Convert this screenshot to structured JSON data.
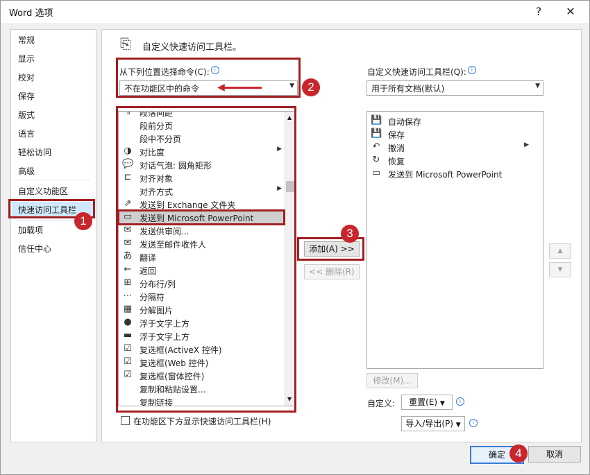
{
  "window": {
    "title": "Word 选项",
    "help": "?",
    "close": "✕"
  },
  "nav": {
    "items": [
      "常规",
      "显示",
      "校对",
      "保存",
      "版式",
      "语言",
      "轻松访问",
      "高级",
      "自定义功能区",
      "快速访问工具栏",
      "加载项",
      "信任中心"
    ],
    "selected": "快速访问工具栏"
  },
  "main": {
    "heading": "自定义快速访问工具栏。",
    "choose_label": "从下列位置选择命令(C):",
    "choose_value": "不在功能区中的命令",
    "qat_label": "自定义快速访问工具栏(Q):",
    "qat_value": "用于所有文档(默认)",
    "commands": [
      {
        "label": "段落间距",
        "icon": "paragraph-spacing-icon",
        "glyph": "¶",
        "submenu": false
      },
      {
        "label": "段前分页",
        "icon": "",
        "glyph": "",
        "submenu": false
      },
      {
        "label": "段中不分页",
        "icon": "",
        "glyph": "",
        "submenu": false
      },
      {
        "label": "对比度",
        "icon": "contrast-icon",
        "glyph": "◑",
        "submenu": true
      },
      {
        "label": "对话气泡: 圆角矩形",
        "icon": "speech-bubble-icon",
        "glyph": "💬",
        "submenu": false
      },
      {
        "label": "对齐对象",
        "icon": "align-objects-icon",
        "glyph": "⊏",
        "submenu": false
      },
      {
        "label": "对齐方式",
        "icon": "",
        "glyph": "",
        "submenu": true
      },
      {
        "label": "发送到 Exchange 文件夹",
        "icon": "exchange-folder-icon",
        "glyph": "⇗",
        "submenu": false
      },
      {
        "label": "发送到 Microsoft PowerPoint",
        "icon": "powerpoint-icon",
        "glyph": "▭",
        "submenu": false
      },
      {
        "label": "发送供审阅...",
        "icon": "review-icon",
        "glyph": "✉",
        "submenu": false
      },
      {
        "label": "发送至邮件收件人",
        "icon": "mail-recipient-icon",
        "glyph": "✉",
        "submenu": false
      },
      {
        "label": "翻译",
        "icon": "translate-icon",
        "glyph": "あ",
        "submenu": false
      },
      {
        "label": "返回",
        "icon": "back-icon",
        "glyph": "←",
        "submenu": false
      },
      {
        "label": "分布行/列",
        "icon": "distribute-rows-icon",
        "glyph": "⊞",
        "submenu": false
      },
      {
        "label": "分隔符",
        "icon": "break-icon",
        "glyph": "⋯",
        "submenu": false
      },
      {
        "label": "分解图片",
        "icon": "ungroup-picture-icon",
        "glyph": "▦",
        "submenu": false
      },
      {
        "label": "浮于文字上方",
        "icon": "float-over-text-icon",
        "glyph": "●",
        "submenu": false
      },
      {
        "label": "浮于文字上方",
        "icon": "bring-forward-icon",
        "glyph": "▬",
        "submenu": false
      },
      {
        "label": "复选框(ActiveX 控件)",
        "icon": "checkbox-activex-icon",
        "glyph": "☑",
        "submenu": false
      },
      {
        "label": "复选框(Web 控件)",
        "icon": "checkbox-web-icon",
        "glyph": "☑",
        "submenu": false
      },
      {
        "label": "复选框(窗体控件)",
        "icon": "checkbox-form-icon",
        "glyph": "☑",
        "submenu": false
      },
      {
        "label": "复制和粘贴设置...",
        "icon": "",
        "glyph": "",
        "submenu": false
      },
      {
        "label": "复制链接",
        "icon": "",
        "glyph": "",
        "submenu": false
      }
    ],
    "selected_command": "发送到 Microsoft PowerPoint",
    "qat_items": [
      {
        "label": "自动保存",
        "icon": "autosave-icon",
        "glyph": "💾",
        "submenu": false
      },
      {
        "label": "保存",
        "icon": "save-icon",
        "glyph": "💾",
        "submenu": false
      },
      {
        "label": "撤消",
        "icon": "undo-icon",
        "glyph": "↶",
        "submenu": true
      },
      {
        "label": "恢复",
        "icon": "redo-icon",
        "glyph": "↻",
        "submenu": false
      },
      {
        "label": "发送到 Microsoft PowerPoint",
        "icon": "powerpoint-icon",
        "glyph": "▭",
        "submenu": false
      }
    ],
    "add_button": "添加(A) >>",
    "remove_button": "<< 删除(R)",
    "modify_button": "修改(M)...",
    "customize_label": "自定义:",
    "reset_button": "重置(E)",
    "import_export_button": "导入/导出(P)",
    "show_below_checkbox": "在功能区下方显示快速访问工具栏(H)",
    "show_below_checked": false
  },
  "footer": {
    "ok": "确定",
    "cancel": "取消"
  },
  "badges": [
    "1",
    "2",
    "3",
    "4"
  ],
  "accent_color": "#a31e22"
}
